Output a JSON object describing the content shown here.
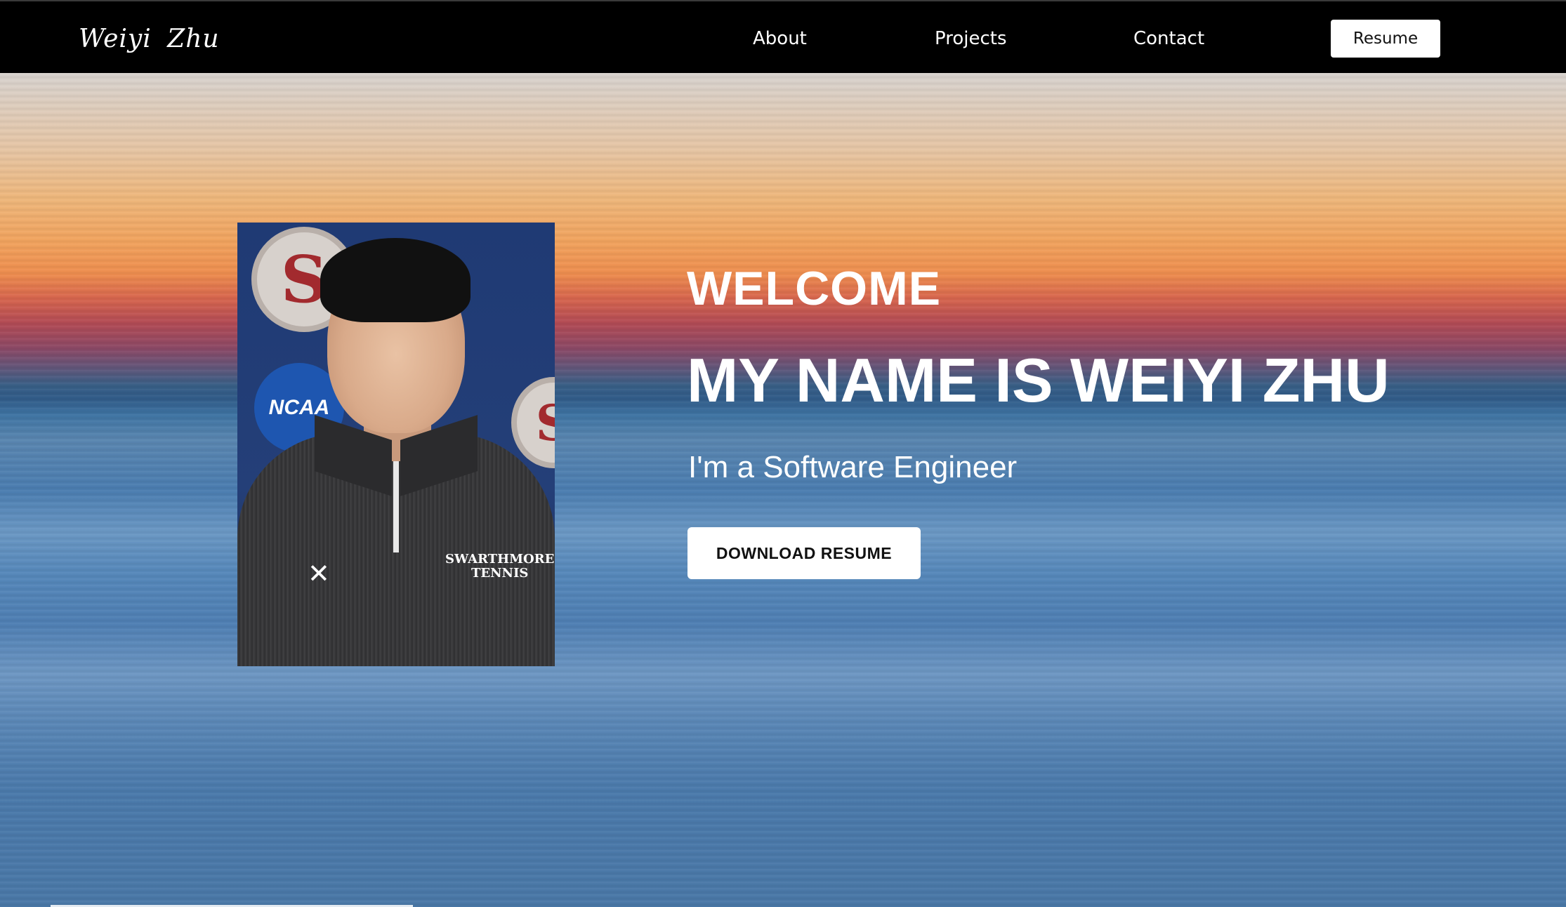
{
  "nav": {
    "brand": "Weiyi  Zhu",
    "links": [
      "About",
      "Projects",
      "Contact"
    ],
    "resume_label": "Resume"
  },
  "hero": {
    "welcome": "WELCOME",
    "name_heading": "MY NAME IS WEIYI ZHU",
    "tagline": "I'm a Software Engineer",
    "download_label": "DOWNLOAD RESUME",
    "photo": {
      "seal_letter": "S",
      "badge_text": "NCAA",
      "shirt_text_line1": "SWARTHMORE",
      "shirt_text_line2": "TENNIS"
    }
  },
  "colors": {
    "nav_bg": "#000000",
    "button_bg": "#ffffff",
    "text_light": "#ffffff"
  }
}
